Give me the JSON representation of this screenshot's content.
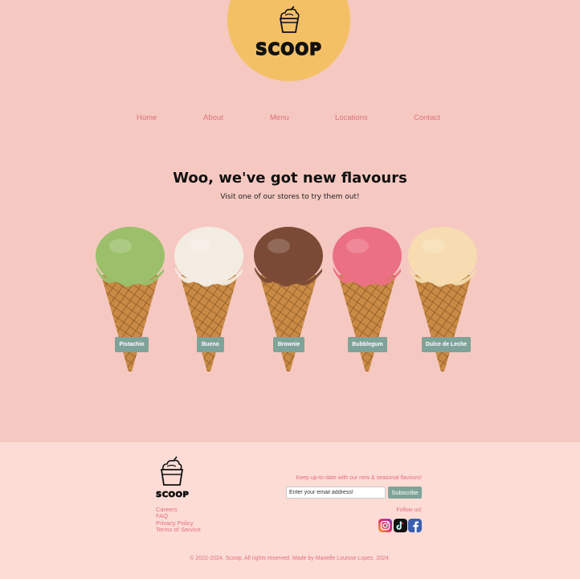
{
  "brand": {
    "name": "SCOOP",
    "logo_icon": "ice-cream-bowl-icon",
    "circle_color": "#f4c065"
  },
  "nav": {
    "items": [
      "Home",
      "About",
      "Menu",
      "Locations",
      "Contact"
    ]
  },
  "hero": {
    "title": "Woo, we've got new flavours",
    "subtitle": "Visit one of our stores to try them out!"
  },
  "flavours": [
    {
      "label": "Pistachio",
      "scoop_color": "#9bbf6a"
    },
    {
      "label": "Bueno",
      "scoop_color": "#f3ece2"
    },
    {
      "label": "Brownie",
      "scoop_color": "#7b4a36"
    },
    {
      "label": "Bubblegum",
      "scoop_color": "#ec7083"
    },
    {
      "label": "Dulce de Leche",
      "scoop_color": "#f6dcb0"
    }
  ],
  "footer": {
    "brand": "SCOOP",
    "links": [
      "Careers",
      "FAQ",
      "Privacy Policy",
      "Terms of Service"
    ],
    "newsletter_label": "Keep up-to-date with our new & seasonal flavours!",
    "email_placeholder": "Enter your email address!",
    "subscribe_label": "Subscribe",
    "follow_label": "Follow us!",
    "social": [
      "instagram-icon",
      "tiktok-icon",
      "facebook-icon"
    ],
    "copyright": "© 2022-2024, Scoop. All rights reserved. Made by Marielle Louisse Lopez, 2024."
  },
  "colors": {
    "background": "#f5c9c1",
    "footer_bg": "#fddcd6",
    "accent": "#e0707a",
    "button": "#7fa398"
  }
}
